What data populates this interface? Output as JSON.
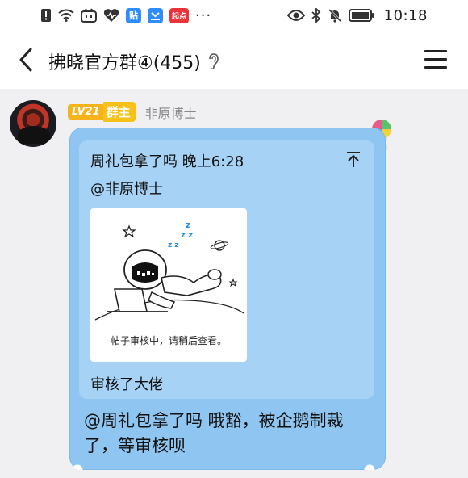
{
  "status_bar": {
    "time": "10:18",
    "more": "···",
    "app_badge_1": "贴",
    "app_badge_2": "起点"
  },
  "header": {
    "title": "拂晓官方群④(455)"
  },
  "message": {
    "level_badge": "LV21",
    "role_badge": "群主",
    "sender_name": "非原博士",
    "quote": {
      "header": "周礼包拿了吗 晚上6:28",
      "mention": "@非原博士",
      "image_caption": "帖子审核中，请稍后查看。",
      "text": "审核了大佬"
    },
    "reply_text": "@周礼包拿了吗 哦豁，被企鹅制裁了，等审核呗"
  },
  "colors": {
    "bubble": "#8ec6f1",
    "quote_bg": "#a6d2f5",
    "role_badge": "#f6c21a",
    "chat_bg": "#f0f0f3"
  }
}
